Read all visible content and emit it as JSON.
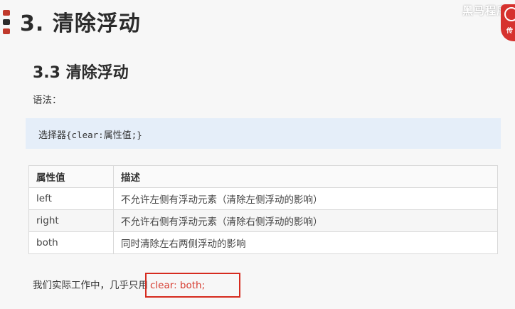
{
  "slide": {
    "title": "3. 清除浮动",
    "subtitle": "3.3 清除浮动",
    "syntax_label": "语法：",
    "code": {
      "prefix": "选择器",
      "mono1": "{clear:",
      "middle": "属性值",
      "mono2": ";}"
    },
    "table": {
      "headers": [
        "属性值",
        "描述"
      ],
      "rows": [
        [
          "left",
          "不允许左侧有浮动元素（清除左侧浮动的影响）"
        ],
        [
          "right",
          "不允许右侧有浮动元素（清除右侧浮动的影响）"
        ],
        [
          "both",
          "同时清除左右两侧浮动的影响"
        ]
      ]
    },
    "note": {
      "text": "我们实际工作中，几乎只用",
      "highlight": "clear: both;"
    },
    "logo": {
      "text": "黑马程序",
      "badge_char": "传"
    }
  },
  "colors": {
    "accent": "#c0392b",
    "highlight_border": "#d62b1f",
    "code_background": "#e5eef9"
  },
  "icons": [
    "title-marker-icon",
    "logo-badge-icon"
  ]
}
